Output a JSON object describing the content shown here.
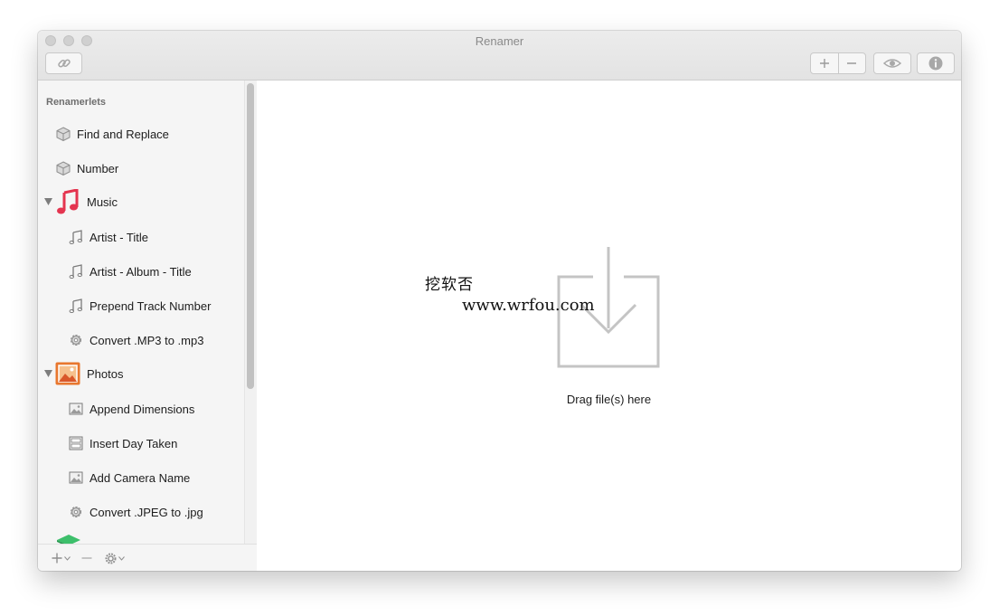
{
  "window": {
    "title": "Renamer"
  },
  "toolbar": {
    "link_icon": "link-icon",
    "add_icon": "plus-icon",
    "remove_icon": "minus-icon",
    "preview_icon": "eye-icon",
    "info_icon": "info-icon"
  },
  "sidebar": {
    "header": "Renamerlets",
    "items": [
      {
        "label": "Find and Replace",
        "icon": "box-icon",
        "level": 1
      },
      {
        "label": "Number",
        "icon": "box-icon",
        "level": 1
      },
      {
        "label": "Music",
        "icon": "music-app-icon",
        "group": true,
        "expanded": true
      },
      {
        "label": "Artist - Title",
        "icon": "music-note-icon",
        "level": 2
      },
      {
        "label": "Artist - Album - Title",
        "icon": "music-note-icon",
        "level": 2
      },
      {
        "label": "Prepend Track Number",
        "icon": "music-note-icon",
        "level": 2
      },
      {
        "label": "Convert .MP3 to .mp3",
        "icon": "gear-icon",
        "level": 2
      },
      {
        "label": "Photos",
        "icon": "photos-app-icon",
        "group": true,
        "expanded": true
      },
      {
        "label": "Append Dimensions",
        "icon": "image-icon",
        "level": 2
      },
      {
        "label": "Insert Day Taken",
        "icon": "film-icon",
        "level": 2
      },
      {
        "label": "Add Camera Name",
        "icon": "image-icon",
        "level": 2
      },
      {
        "label": "Convert .JPEG to .jpg",
        "icon": "gear-icon",
        "level": 2
      }
    ],
    "footer": {
      "add_icon": "plus-icon",
      "remove_icon": "minus-icon",
      "settings_icon": "gear-icon"
    }
  },
  "main": {
    "drop_text": "Drag file(s) here"
  },
  "watermark": {
    "line1": "挖软否",
    "line2": "www.wrfou.com"
  },
  "colors": {
    "music": "#e4344f",
    "photos": "#e8772e"
  }
}
